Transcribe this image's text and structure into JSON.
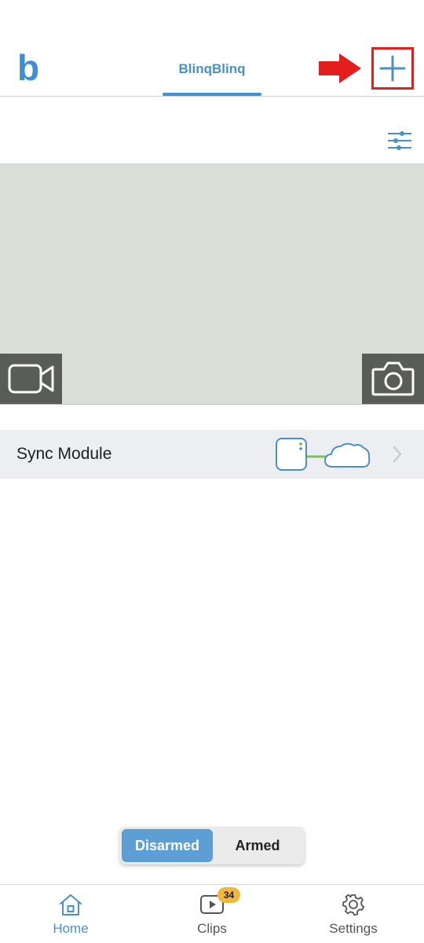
{
  "app": {
    "logo": "b",
    "system_tab": "BlinqBlinq"
  },
  "colors": {
    "accent": "#4a90c8",
    "highlight_box": "#e41d1d",
    "camera_placeholder": "#dae0d8",
    "sync_row_bg": "#edeef2",
    "badge": "#f1b73c"
  },
  "header": {
    "add_icon": "plus-icon",
    "arrow_icon": "red-arrow-right-icon"
  },
  "filter": {
    "icon": "sliders-icon"
  },
  "camera": {
    "record_icon": "video-camera-icon",
    "snapshot_icon": "photo-camera-icon"
  },
  "sync_module": {
    "label": "Sync Module",
    "status_icon": "sync-module-cloud-connected-icon",
    "chevron_icon": "chevron-right-icon"
  },
  "arm_toggle": {
    "disarmed_label": "Disarmed",
    "armed_label": "Armed",
    "selected": "Disarmed"
  },
  "bottom_nav": {
    "home_label": "Home",
    "clips_label": "Clips",
    "clips_badge": "34",
    "settings_label": "Settings"
  }
}
